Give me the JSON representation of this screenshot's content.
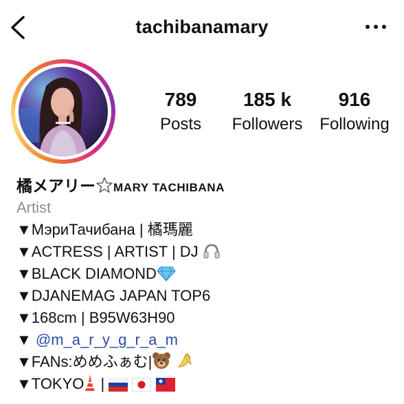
{
  "header": {
    "username": "tachibanamary",
    "back_icon": "chevron-left-icon",
    "more_icon": "more-dots-icon"
  },
  "profile": {
    "avatar": "profile-photo"
  },
  "stats": [
    {
      "value": "789",
      "label": "Posts"
    },
    {
      "value": "185 k",
      "label": "Followers"
    },
    {
      "value": "916",
      "label": "Following"
    }
  ],
  "bio": {
    "name_jp": "橘メアリー",
    "name_en": "MARY TACHIBANA",
    "category": "Artist",
    "line1": "▼МэриТачибана | 橘瑪麗",
    "line2": "▼ACTRESS | ARTIST | DJ",
    "line3": "▼BLACK DIAMOND",
    "line4": "▼DJANEMAG JAPAN TOP6",
    "line5": "▼168cm | B95W63H90",
    "line6_prefix": "▼",
    "mention": "@m_a_r_y_g_r_a_m",
    "line7": "▼FANs:めめふぁむ|",
    "line8_prefix": "▼TOKYO",
    "sep": "|"
  },
  "colors": {
    "accent_link": "#2a4fa5",
    "muted": "#8e8e8e",
    "ring_start": "#f58529",
    "ring_end": "#dd2a7b"
  }
}
